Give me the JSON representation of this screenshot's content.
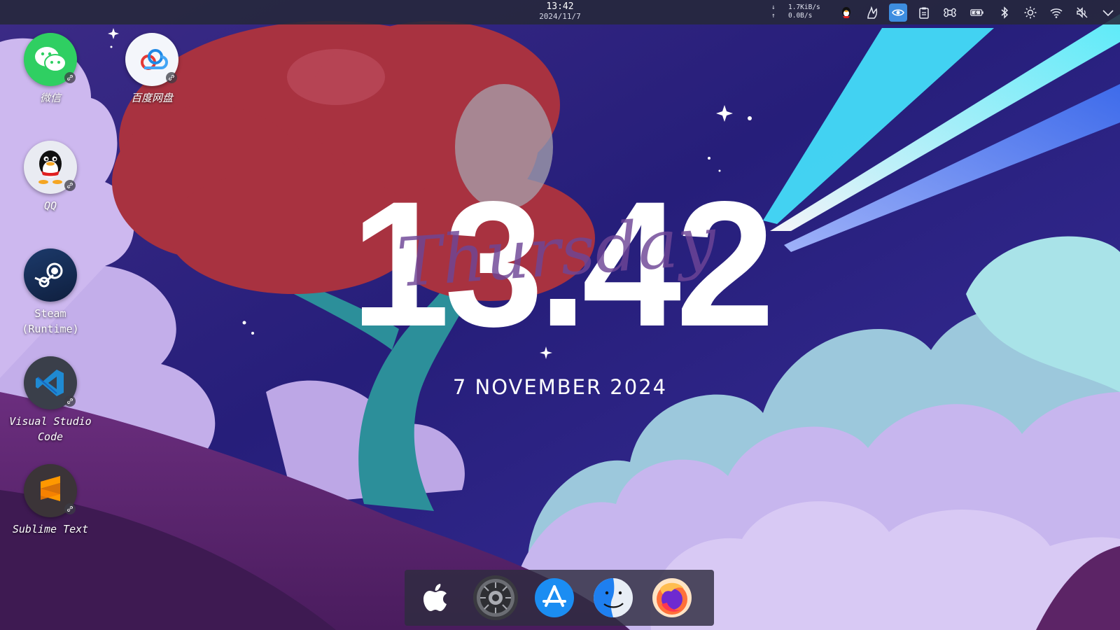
{
  "topbar": {
    "time": "13:42",
    "date": "2024/11/7",
    "network": {
      "download": "1.7KiB/s",
      "upload": "0.0B/s",
      "down_arrow": "↓",
      "up_arrow": "↑"
    },
    "tray_icons": [
      "qq-tray-icon",
      "flame-icon",
      "eye-icon",
      "clipboard-icon",
      "command-icon",
      "battery-icon",
      "bluetooth-icon",
      "brightness-icon",
      "wifi-icon",
      "muted-speaker-icon",
      "chevron-down-icon"
    ]
  },
  "desktop_icons": [
    {
      "label": "微信",
      "icon": "wechat-icon"
    },
    {
      "label": "百度网盘",
      "icon": "baidu-netdisk-icon"
    },
    {
      "label": "QQ",
      "icon": "qq-icon"
    },
    {
      "label": "Steam\n(Runtime)",
      "icon": "steam-icon"
    },
    {
      "label": "Visual Studio\nCode",
      "icon": "vscode-icon"
    },
    {
      "label": "Sublime Text",
      "icon": "sublime-text-icon"
    }
  ],
  "clock_widget": {
    "time": "13.42",
    "day": "Thursday",
    "date": "7 NOVEMBER 2024"
  },
  "dock": {
    "items": [
      "apple-icon",
      "system-settings-icon",
      "app-store-icon",
      "finder-icon",
      "firefox-icon"
    ]
  },
  "colors": {
    "panel": "#26283a",
    "sky": "#2b1f78",
    "tree": "#a8303d",
    "cloud": "#c9b4ec",
    "beam": "#7ff2ff"
  }
}
